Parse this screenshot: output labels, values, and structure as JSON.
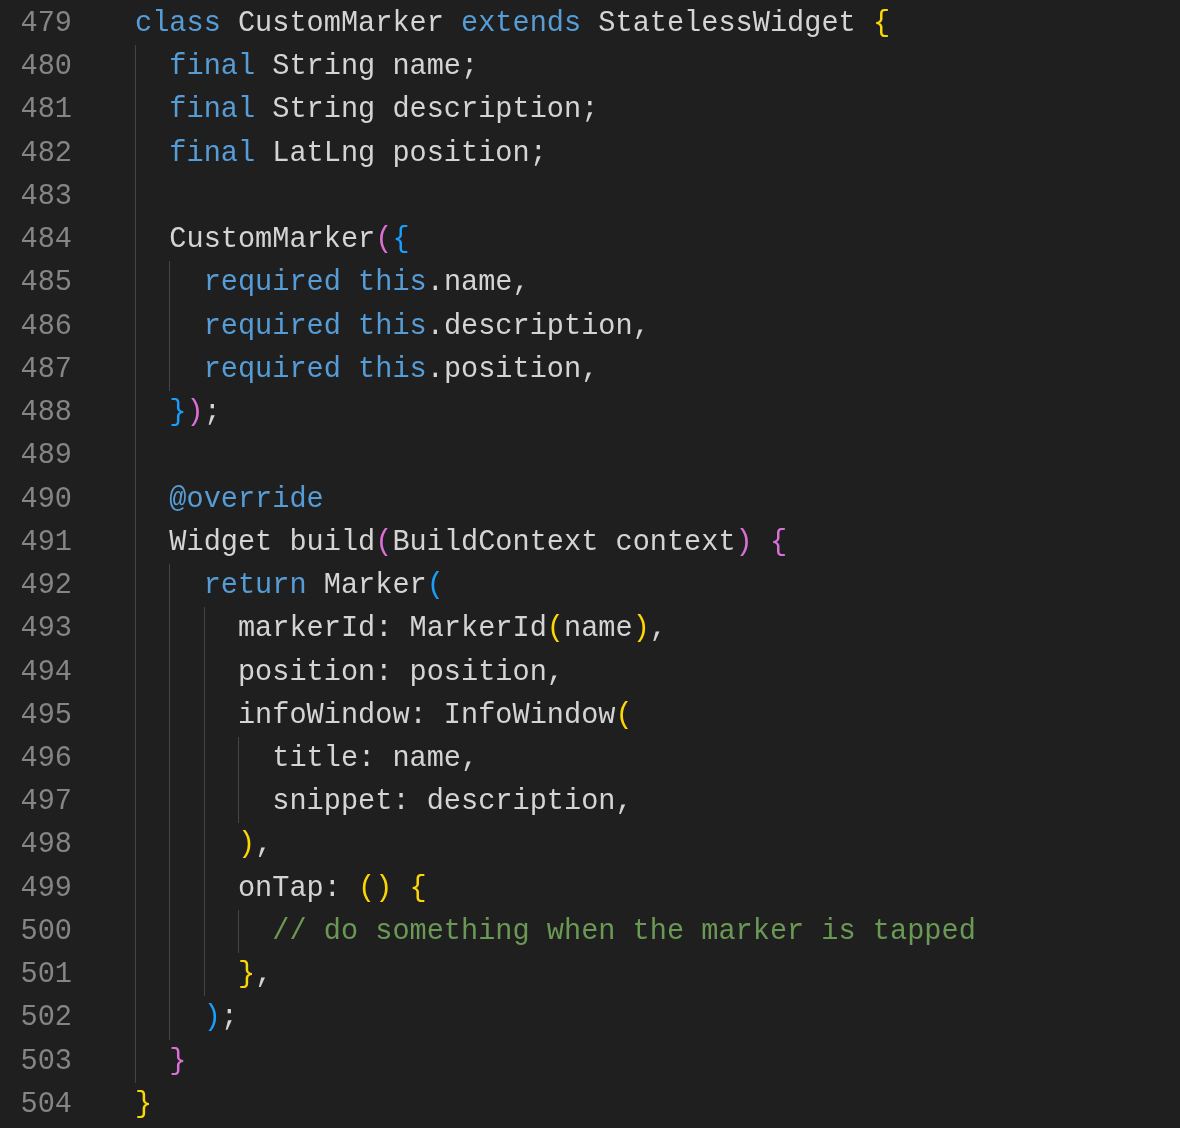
{
  "editor": {
    "lines": [
      {
        "number": "479",
        "tokens": [
          {
            "kind": "keyword",
            "text": "class"
          },
          {
            "kind": "plain",
            "text": " CustomMarker "
          },
          {
            "kind": "keyword",
            "text": "extends"
          },
          {
            "kind": "plain",
            "text": " StatelessWidget "
          },
          {
            "kind": "bracket1",
            "text": "{"
          }
        ]
      },
      {
        "number": "480",
        "tokens": [
          {
            "kind": "keyword",
            "text": "  final"
          },
          {
            "kind": "plain",
            "text": " String name;"
          }
        ]
      },
      {
        "number": "481",
        "tokens": [
          {
            "kind": "keyword",
            "text": "  final"
          },
          {
            "kind": "plain",
            "text": " String description;"
          }
        ]
      },
      {
        "number": "482",
        "tokens": [
          {
            "kind": "keyword",
            "text": "  final"
          },
          {
            "kind": "plain",
            "text": " LatLng position;"
          }
        ]
      },
      {
        "number": "483"
      },
      {
        "number": "484",
        "tokens": [
          {
            "kind": "plain",
            "text": "  CustomMarker"
          },
          {
            "kind": "bracket2",
            "text": "("
          },
          {
            "kind": "bracket3",
            "text": "{"
          }
        ]
      },
      {
        "number": "485",
        "tokens": [
          {
            "kind": "keyword",
            "text": "    required this"
          },
          {
            "kind": "plain",
            "text": ".name,"
          }
        ]
      },
      {
        "number": "486",
        "tokens": [
          {
            "kind": "keyword",
            "text": "    required this"
          },
          {
            "kind": "plain",
            "text": ".description,"
          }
        ]
      },
      {
        "number": "487",
        "tokens": [
          {
            "kind": "keyword",
            "text": "    required this"
          },
          {
            "kind": "plain",
            "text": ".position,"
          }
        ]
      },
      {
        "number": "488",
        "tokens": [
          {
            "kind": "bracket3",
            "text": "  }"
          },
          {
            "kind": "bracket2",
            "text": ")"
          },
          {
            "kind": "plain",
            "text": ";"
          }
        ]
      },
      {
        "number": "489"
      },
      {
        "number": "490",
        "tokens": [
          {
            "kind": "keyword",
            "text": "  @override"
          }
        ]
      },
      {
        "number": "491",
        "tokens": [
          {
            "kind": "plain",
            "text": "  Widget build"
          },
          {
            "kind": "bracket2",
            "text": "("
          },
          {
            "kind": "plain",
            "text": "BuildContext context"
          },
          {
            "kind": "bracket2",
            "text": ") {"
          }
        ]
      },
      {
        "number": "492",
        "tokens": [
          {
            "kind": "keyword",
            "text": "    return"
          },
          {
            "kind": "plain",
            "text": " Marker"
          },
          {
            "kind": "bracket3",
            "text": "("
          }
        ]
      },
      {
        "number": "493",
        "tokens": [
          {
            "kind": "plain",
            "text": "      markerId: MarkerId"
          },
          {
            "kind": "bracket1",
            "text": "("
          },
          {
            "kind": "plain",
            "text": "name"
          },
          {
            "kind": "bracket1",
            "text": ")"
          },
          {
            "kind": "plain",
            "text": ","
          }
        ]
      },
      {
        "number": "494",
        "tokens": [
          {
            "kind": "plain",
            "text": "      position: position,"
          }
        ]
      },
      {
        "number": "495",
        "tokens": [
          {
            "kind": "plain",
            "text": "      infoWindow: InfoWindow"
          },
          {
            "kind": "bracket1",
            "text": "("
          }
        ]
      },
      {
        "number": "496",
        "tokens": [
          {
            "kind": "plain",
            "text": "        title: name,"
          }
        ]
      },
      {
        "number": "497",
        "tokens": [
          {
            "kind": "plain",
            "text": "        snippet: description,"
          }
        ]
      },
      {
        "number": "498",
        "tokens": [
          {
            "kind": "bracket1",
            "text": "      )"
          },
          {
            "kind": "plain",
            "text": ","
          }
        ]
      },
      {
        "number": "499",
        "tokens": [
          {
            "kind": "plain",
            "text": "      onTap: "
          },
          {
            "kind": "bracket1",
            "text": "() {"
          }
        ]
      },
      {
        "number": "500",
        "tokens": [
          {
            "kind": "comment",
            "text": "        // do something when the marker is tapped"
          }
        ]
      },
      {
        "number": "501",
        "tokens": [
          {
            "kind": "bracket1",
            "text": "      }"
          },
          {
            "kind": "plain",
            "text": ","
          }
        ]
      },
      {
        "number": "502",
        "tokens": [
          {
            "kind": "bracket3",
            "text": "    )"
          },
          {
            "kind": "plain",
            "text": ";"
          }
        ]
      },
      {
        "number": "503",
        "tokens": [
          {
            "kind": "bracket2",
            "text": "  }"
          }
        ]
      },
      {
        "number": "504",
        "tokens": [
          {
            "kind": "bracket1",
            "text": "}"
          }
        ]
      }
    ]
  }
}
